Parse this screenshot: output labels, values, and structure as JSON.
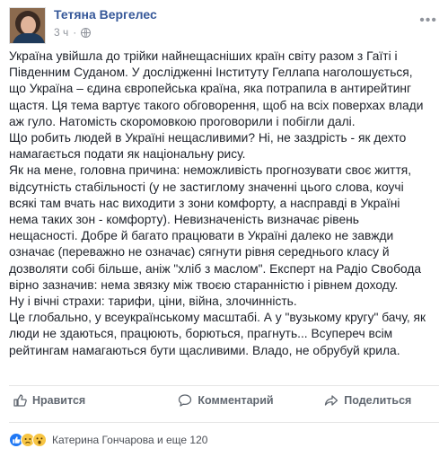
{
  "post": {
    "author": "Тетяна Вергелес",
    "time": "3 ч",
    "dot": "·",
    "text_lines": [
      "Україна увійшла до трійки найнещасніших країн світу разом з Гаїті і",
      "Південним Суданом. У дослідженні Інституту Геллапа наголошується,",
      "що Україна – єдина європейська країна, яка потрапила в антирейтинг",
      "щастя. Ця тема вартує такого обговорення, щоб на всіх поверхах влади",
      "аж гуло. Натомість скоромовкою проговорили і побігли далі.",
      "Що робить людей в Україні нещасливими? Ні, не заздрість - як дехто",
      "намагається подати як національну рису.",
      "Як на мене, головна причина: неможливість прогнозувати своє життя,",
      "відсутність стабільності (у не застиглому значенні цього слова, коучі",
      "всякі там вчать нас виходити з зони комфорту, а насправді в Україні",
      "нема таких зон - комфорту). Невизначеність визначає рівень",
      "нещасності. Добре й багато працювати в Україні далеко не завжди",
      "означає (переважно не означає) сягнути рівня середнього класу й",
      "дозволяти собі більше, аніж \"хліб з маслом\". Експерт на Радіо Свобода",
      "вірно зазначив: нема звязку між твоєю старанністю і рівнем доходу.",
      "Ну і вічні страхи: тарифи, ціни, війна, злочинність.",
      "Це глобально, у всеукраїнському масштабі. А у \"вузькому кругу\" бачу, як",
      "люди не здаються, працюють, борються, прагнуть... Всупереч всім",
      "рейтингам намагаються бути щасливими. Владо, не обрубуй крила."
    ]
  },
  "actions": {
    "like": "Нравится",
    "comment": "Комментарий",
    "share": "Поделиться"
  },
  "reactions": {
    "names": "Катерина Гончарова и еще 120",
    "icons": [
      "like-icon",
      "sad-icon",
      "wow-icon"
    ]
  },
  "colors": {
    "link": "#365899",
    "muted": "#90949c",
    "action": "#606770",
    "like": "#2078f4",
    "emoji": "#f7c544"
  }
}
